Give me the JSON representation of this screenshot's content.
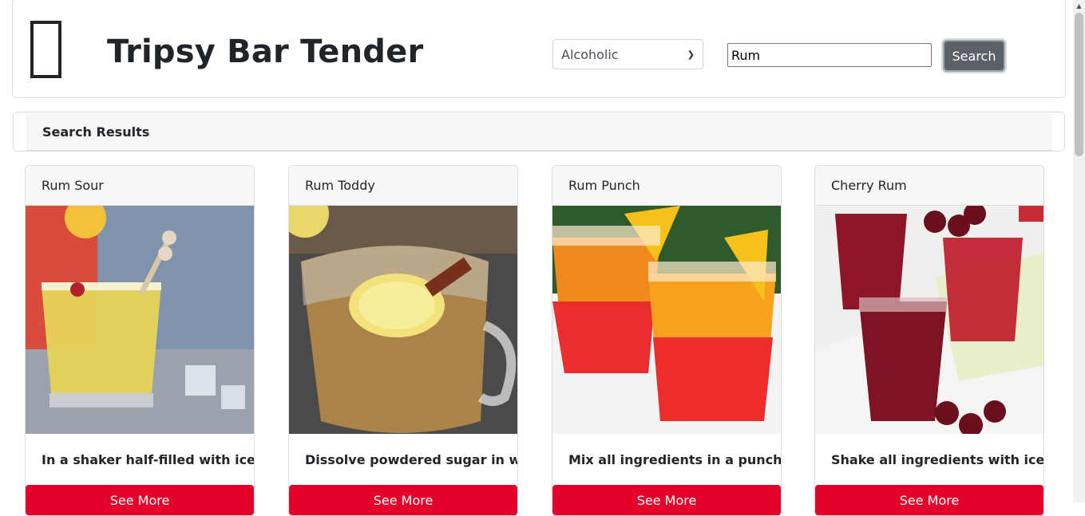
{
  "app": {
    "title": "Tripsy Bar Tender"
  },
  "search": {
    "category": "Alcoholic",
    "query": "Rum",
    "button_label": "Search"
  },
  "results": {
    "header": "Search Results",
    "cards": [
      {
        "name": "Rum Sour",
        "description": "In a shaker half-filled with ice ...",
        "button": "See More"
      },
      {
        "name": "Rum Toddy",
        "description": "Dissolve powdered sugar in w...",
        "button": "See More"
      },
      {
        "name": "Rum Punch",
        "description": "Mix all ingredients in a punch ...",
        "button": "See More"
      },
      {
        "name": "Cherry Rum",
        "description": "Shake all ingredients with ice,...",
        "button": "See More"
      }
    ]
  },
  "colors": {
    "accent": "#e4002b",
    "button": "#5a6268"
  }
}
